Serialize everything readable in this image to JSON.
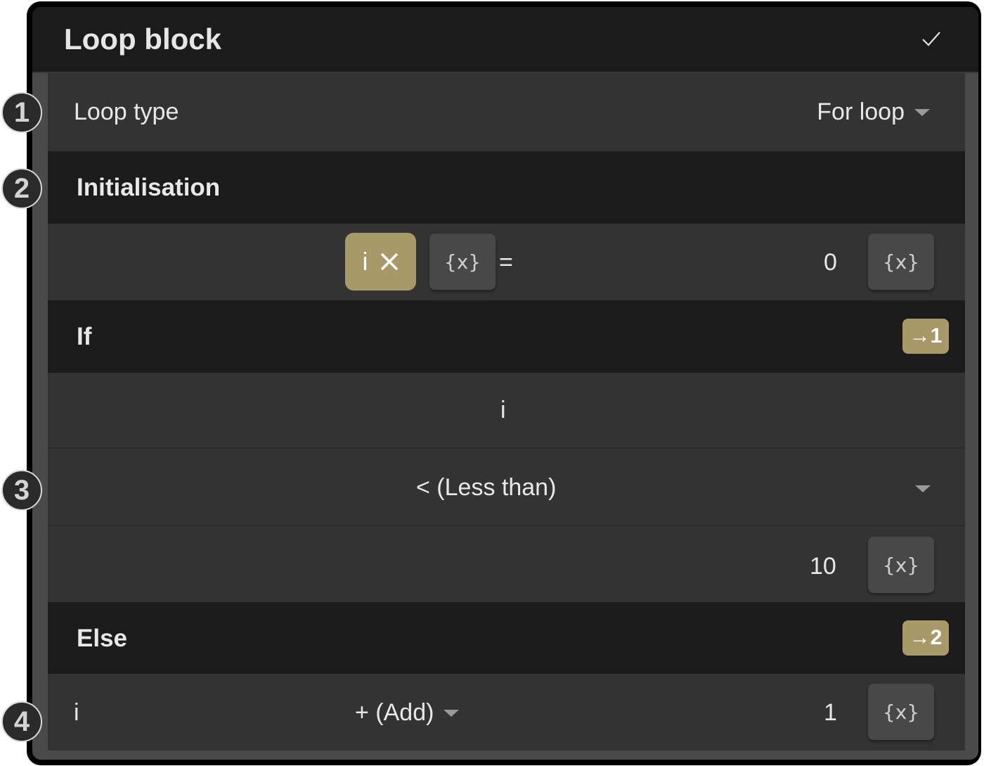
{
  "window": {
    "title": "Loop block",
    "confirm_icon": "checkmark-icon"
  },
  "colors": {
    "accent": "#a89968",
    "header_bg": "#1b1b1b",
    "row_bg": "#333333",
    "gutter_bg": "#4a4a4a",
    "var_button_bg": "#484848"
  },
  "loop_type": {
    "label": "Loop type",
    "value": "For loop"
  },
  "initialisation": {
    "header": "Initialisation",
    "variable_chip": "i",
    "chip_remove_icon": "×",
    "var_button_label": "{x}",
    "equals": "=",
    "value": "0",
    "value_var_button_label": "{x}"
  },
  "if_section": {
    "header": "If",
    "goto_badge": "→1",
    "left_operand": "i",
    "operator": "< (Less than)",
    "right_operand": "10",
    "right_var_button_label": "{x}"
  },
  "else_section": {
    "header": "Else",
    "goto_badge": "→2"
  },
  "increment": {
    "variable": "i",
    "operator": "+ (Add)",
    "value": "1",
    "var_button_label": "{x}"
  },
  "callouts": [
    "1",
    "2",
    "3",
    "4"
  ]
}
